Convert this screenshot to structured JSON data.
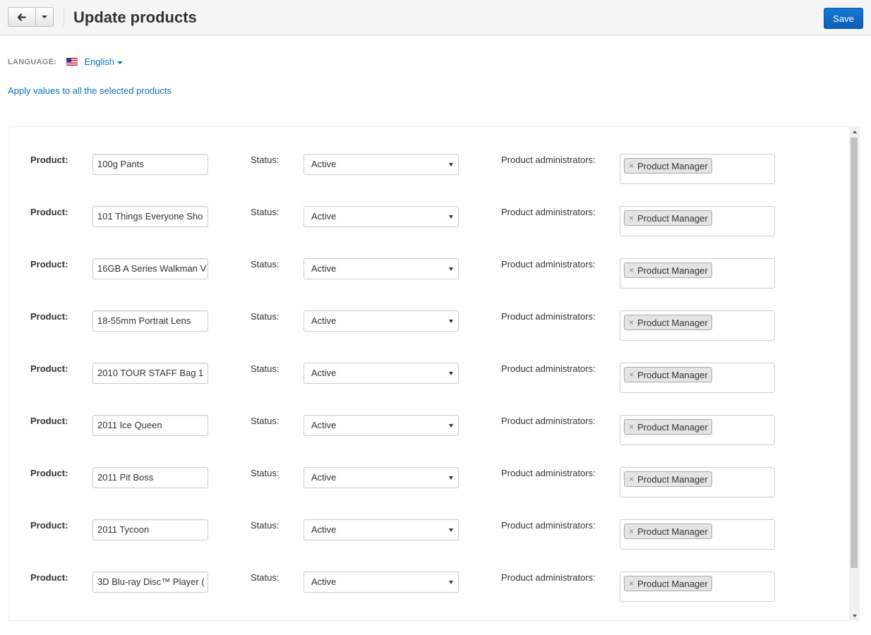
{
  "header": {
    "title": "Update products",
    "back_icon": "arrow-left-icon",
    "save_label": "Save"
  },
  "language": {
    "label": "LANGUAGE:",
    "value": "English",
    "flag_icon": "us-flag-icon"
  },
  "apply_all_link": "Apply values to all the selected products",
  "columns": {
    "product_label": "Product:",
    "status_label": "Status:",
    "admins_label": "Product administrators:"
  },
  "rows": [
    {
      "product": "100g Pants",
      "status": "Active",
      "admin": "Product Manager"
    },
    {
      "product": "101 Things Everyone Sho",
      "status": "Active",
      "admin": "Product Manager"
    },
    {
      "product": "16GB A Series Walkman V",
      "status": "Active",
      "admin": "Product Manager"
    },
    {
      "product": "18-55mm Portrait Lens",
      "status": "Active",
      "admin": "Product Manager"
    },
    {
      "product": "2010 TOUR STAFF Bag 1",
      "status": "Active",
      "admin": "Product Manager"
    },
    {
      "product": "2011 Ice Queen",
      "status": "Active",
      "admin": "Product Manager"
    },
    {
      "product": "2011 Pit Boss",
      "status": "Active",
      "admin": "Product Manager"
    },
    {
      "product": "2011 Tycoon",
      "status": "Active",
      "admin": "Product Manager"
    },
    {
      "product": "3D Blu-ray Disc™ Player (",
      "status": "Active",
      "admin": "Product Manager"
    }
  ],
  "colors": {
    "link": "#0b72b5",
    "save_button": "#0c6fd0",
    "tag_background": "#e4e4e4"
  }
}
